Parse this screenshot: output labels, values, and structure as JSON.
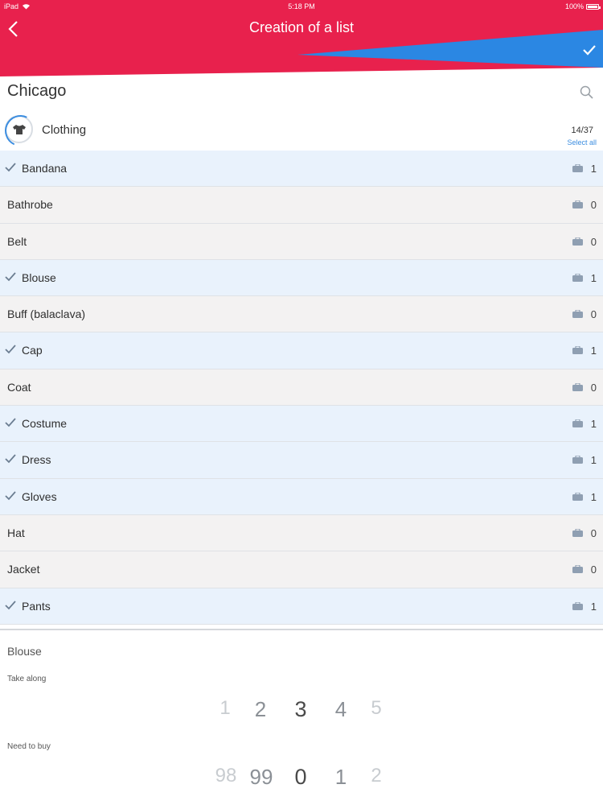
{
  "status_bar": {
    "device": "iPad",
    "time": "5:18 PM",
    "battery": "100%"
  },
  "header": {
    "title": "Creation of a list",
    "accent_red": "#e8214d",
    "accent_blue": "#2b87e3"
  },
  "location": "Chicago",
  "category": {
    "label": "Clothing",
    "count": "14/37",
    "select_all": "Select all"
  },
  "items": [
    {
      "name": "Bandana",
      "qty": "1",
      "checked": true
    },
    {
      "name": "Bathrobe",
      "qty": "0",
      "checked": false
    },
    {
      "name": "Belt",
      "qty": "0",
      "checked": false
    },
    {
      "name": "Blouse",
      "qty": "1",
      "checked": true
    },
    {
      "name": "Buff (balaclava)",
      "qty": "0",
      "checked": false
    },
    {
      "name": "Cap",
      "qty": "1",
      "checked": true
    },
    {
      "name": "Coat",
      "qty": "0",
      "checked": false
    },
    {
      "name": "Costume",
      "qty": "1",
      "checked": true
    },
    {
      "name": "Dress",
      "qty": "1",
      "checked": true
    },
    {
      "name": "Gloves",
      "qty": "1",
      "checked": true
    },
    {
      "name": "Hat",
      "qty": "0",
      "checked": false
    },
    {
      "name": "Jacket",
      "qty": "0",
      "checked": false
    },
    {
      "name": "Pants",
      "qty": "1",
      "checked": true
    }
  ],
  "detail": {
    "title": "Blouse",
    "take_along_label": "Take along",
    "take_along_options": [
      "1",
      "2",
      "3",
      "4",
      "5"
    ],
    "take_along_selected": "3",
    "need_to_buy_label": "Need to buy",
    "need_to_buy_options": [
      "98",
      "99",
      "0",
      "1",
      "2"
    ],
    "need_to_buy_selected": "0"
  }
}
